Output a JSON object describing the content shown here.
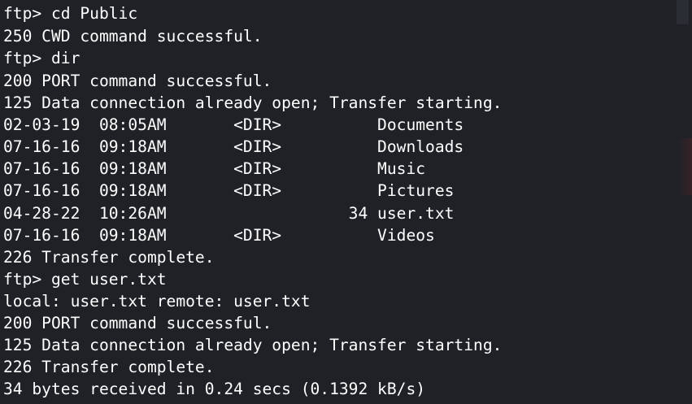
{
  "terminal": {
    "lines": [
      "ftp> cd Public",
      "250 CWD command successful.",
      "ftp> dir",
      "200 PORT command successful.",
      "125 Data connection already open; Transfer starting.",
      "02-03-19  08:05AM       <DIR>          Documents",
      "07-16-16  09:18AM       <DIR>          Downloads",
      "07-16-16  09:18AM       <DIR>          Music",
      "07-16-16  09:18AM       <DIR>          Pictures",
      "04-28-22  10:26AM                   34 user.txt",
      "07-16-16  09:18AM       <DIR>          Videos",
      "226 Transfer complete.",
      "ftp> get user.txt",
      "local: user.txt remote: user.txt",
      "200 PORT command successful.",
      "125 Data connection already open; Transfer starting.",
      "226 Transfer complete.",
      "34 bytes received in 0.24 secs (0.1392 kB/s)"
    ]
  },
  "colors": {
    "background": "#1f2127",
    "text": "#ffffff"
  }
}
